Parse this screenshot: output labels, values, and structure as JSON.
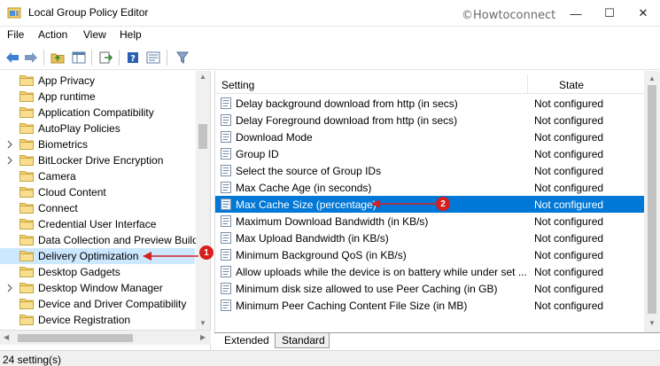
{
  "window": {
    "title": "Local Group Policy Editor",
    "watermark": "©Howtoconnect",
    "minimize_glyph": "—",
    "maximize_glyph": "☐",
    "close_glyph": "✕"
  },
  "menu": [
    "File",
    "Action",
    "View",
    "Help"
  ],
  "toolbar": {
    "icons": [
      "back-arrow-icon",
      "forward-arrow-icon",
      "up-folder-icon",
      "show-hide-tree-icon",
      "export-list-icon",
      "help-icon",
      "properties-icon",
      "filter-icon"
    ]
  },
  "tree": {
    "items": [
      {
        "label": "App Privacy",
        "expandable": false,
        "selected": false
      },
      {
        "label": "App runtime",
        "expandable": false,
        "selected": false
      },
      {
        "label": "Application Compatibility",
        "expandable": false,
        "selected": false
      },
      {
        "label": "AutoPlay Policies",
        "expandable": false,
        "selected": false
      },
      {
        "label": "Biometrics",
        "expandable": true,
        "selected": false
      },
      {
        "label": "BitLocker Drive Encryption",
        "expandable": true,
        "selected": false
      },
      {
        "label": "Camera",
        "expandable": false,
        "selected": false
      },
      {
        "label": "Cloud Content",
        "expandable": false,
        "selected": false
      },
      {
        "label": "Connect",
        "expandable": false,
        "selected": false
      },
      {
        "label": "Credential User Interface",
        "expandable": false,
        "selected": false
      },
      {
        "label": "Data Collection and Preview Builds",
        "expandable": false,
        "selected": false
      },
      {
        "label": "Delivery Optimization",
        "expandable": false,
        "selected": true
      },
      {
        "label": "Desktop Gadgets",
        "expandable": false,
        "selected": false
      },
      {
        "label": "Desktop Window Manager",
        "expandable": true,
        "selected": false
      },
      {
        "label": "Device and Driver Compatibility",
        "expandable": false,
        "selected": false
      },
      {
        "label": "Device Registration",
        "expandable": false,
        "selected": false
      }
    ]
  },
  "list": {
    "columns": {
      "setting": "Setting",
      "state": "State"
    },
    "rows": [
      {
        "name": "Delay background download from http (in secs)",
        "state": "Not configured",
        "selected": false
      },
      {
        "name": "Delay Foreground download from http (in secs)",
        "state": "Not configured",
        "selected": false
      },
      {
        "name": "Download Mode",
        "state": "Not configured",
        "selected": false
      },
      {
        "name": "Group ID",
        "state": "Not configured",
        "selected": false
      },
      {
        "name": "Select the source of Group IDs",
        "state": "Not configured",
        "selected": false
      },
      {
        "name": "Max Cache Age (in seconds)",
        "state": "Not configured",
        "selected": false
      },
      {
        "name": "Max Cache Size (percentage)",
        "state": "Not configured",
        "selected": true
      },
      {
        "name": "Maximum Download Bandwidth (in KB/s)",
        "state": "Not configured",
        "selected": false
      },
      {
        "name": "Max Upload Bandwidth (in KB/s)",
        "state": "Not configured",
        "selected": false
      },
      {
        "name": "Minimum Background QoS (in KB/s)",
        "state": "Not configured",
        "selected": false
      },
      {
        "name": "Allow uploads while the device is on battery while under set ...",
        "state": "Not configured",
        "selected": false
      },
      {
        "name": "Minimum disk size allowed to use Peer Caching (in GB)",
        "state": "Not configured",
        "selected": false
      },
      {
        "name": "Minimum Peer Caching Content File Size (in MB)",
        "state": "Not configured",
        "selected": false
      }
    ]
  },
  "tabs": [
    {
      "label": "Extended",
      "active": false
    },
    {
      "label": "Standard",
      "active": true
    }
  ],
  "status": "24 setting(s)",
  "annotations": [
    {
      "number": "1",
      "color": "#d61f1f"
    },
    {
      "number": "2",
      "color": "#d61f1f"
    }
  ]
}
